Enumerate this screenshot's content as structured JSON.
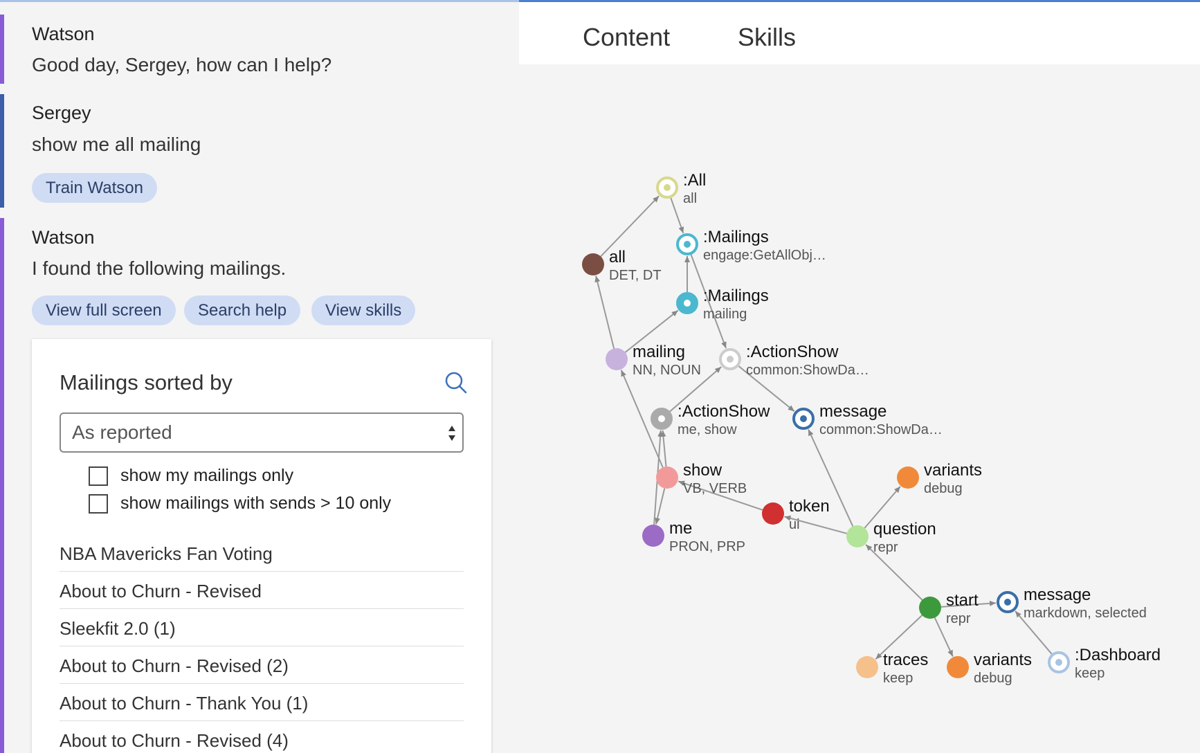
{
  "chat": {
    "messages": [
      {
        "author": "Watson",
        "text": "Good day, Sergey, how can I help?"
      },
      {
        "author": "Sergey",
        "text": "show me all mailing",
        "action": "Train Watson"
      },
      {
        "author": "Watson",
        "text": "I found the following mailings.",
        "actions": [
          "View full screen",
          "Search help",
          "View skills"
        ]
      }
    ]
  },
  "mailings": {
    "title": "Mailings sorted by",
    "sort_value": "As reported",
    "filters": [
      "show my mailings only",
      "show mailings with sends > 10 only"
    ],
    "rows": [
      "NBA Mavericks Fan Voting",
      "About to Churn - Revised",
      "Sleekfit 2.0 (1)",
      "About to Churn - Revised (2)",
      "About to Churn - Thank You (1)",
      "About to Churn - Revised (4)"
    ]
  },
  "tabs": [
    "Content",
    "Skills"
  ],
  "colors": {
    "watson_bar": "#8a5bd6",
    "user_bar": "#3b5fa8",
    "pill_bg": "#cfdcf4",
    "accent_blue": "#4a7fd1"
  },
  "graph": {
    "nodes": [
      {
        "id": "all_ent",
        "label": ":All",
        "sub": "all",
        "color": "#d8d88c",
        "style": "ring"
      },
      {
        "id": "mail_ent",
        "label": ":Mailings",
        "sub": "engage:GetAllObj…",
        "color": "#4bb8d0",
        "style": "ring"
      },
      {
        "id": "all_tok",
        "label": "all",
        "sub": "DET, DT",
        "color": "#7b4e44",
        "style": "solid"
      },
      {
        "id": "mail_ent2",
        "label": ":Mailings",
        "sub": "mailing",
        "color": "#4bb8d0",
        "style": "filledring"
      },
      {
        "id": "mailing",
        "label": "mailing",
        "sub": "NN, NOUN",
        "color": "#c7b2de",
        "style": "solid"
      },
      {
        "id": "act1",
        "label": ":ActionShow",
        "sub": "common:ShowDa…",
        "color": "#cccccc",
        "style": "ring"
      },
      {
        "id": "act2",
        "label": ":ActionShow",
        "sub": "me, show",
        "color": "#aaaaaa",
        "style": "filledring"
      },
      {
        "id": "message1",
        "label": "message",
        "sub": "common:ShowDa…",
        "color": "#3a6ea8",
        "style": "ring"
      },
      {
        "id": "show",
        "label": "show",
        "sub": "VB, VERB",
        "color": "#f29a9a",
        "style": "solid"
      },
      {
        "id": "variants1",
        "label": "variants",
        "sub": "debug",
        "color": "#f08a3a",
        "style": "solid"
      },
      {
        "id": "token",
        "label": "token",
        "sub": "ui",
        "color": "#d03030",
        "style": "solid"
      },
      {
        "id": "me",
        "label": "me",
        "sub": "PRON, PRP",
        "color": "#9b6bc6",
        "style": "solid"
      },
      {
        "id": "question",
        "label": "question",
        "sub": "repr",
        "color": "#b2e49a",
        "style": "solid"
      },
      {
        "id": "start",
        "label": "start",
        "sub": "repr",
        "color": "#3c9a3c",
        "style": "solid"
      },
      {
        "id": "message2",
        "label": "message",
        "sub": "markdown, selected",
        "color": "#3a6ea8",
        "style": "ring"
      },
      {
        "id": "traces",
        "label": "traces",
        "sub": "keep",
        "color": "#f5c08a",
        "style": "solid"
      },
      {
        "id": "variants2",
        "label": "variants",
        "sub": "debug",
        "color": "#f08a3a",
        "style": "solid"
      },
      {
        "id": "dashboard",
        "label": ":Dashboard",
        "sub": "keep",
        "color": "#a8c4e4",
        "style": "ring"
      }
    ],
    "edges": [
      [
        "all_tok",
        "all_ent"
      ],
      [
        "all_ent",
        "mail_ent"
      ],
      [
        "mail_ent2",
        "mail_ent"
      ],
      [
        "mail_ent",
        "act1"
      ],
      [
        "mailing",
        "mail_ent2"
      ],
      [
        "mailing",
        "all_tok"
      ],
      [
        "act2",
        "act1"
      ],
      [
        "act1",
        "message1"
      ],
      [
        "show",
        "act2"
      ],
      [
        "show",
        "mailing"
      ],
      [
        "me",
        "act2"
      ],
      [
        "show",
        "me"
      ],
      [
        "token",
        "show"
      ],
      [
        "question",
        "token"
      ],
      [
        "question",
        "message1"
      ],
      [
        "question",
        "variants1"
      ],
      [
        "start",
        "question"
      ],
      [
        "start",
        "message2"
      ],
      [
        "start",
        "traces"
      ],
      [
        "start",
        "variants2"
      ],
      [
        "dashboard",
        "message2"
      ]
    ]
  }
}
